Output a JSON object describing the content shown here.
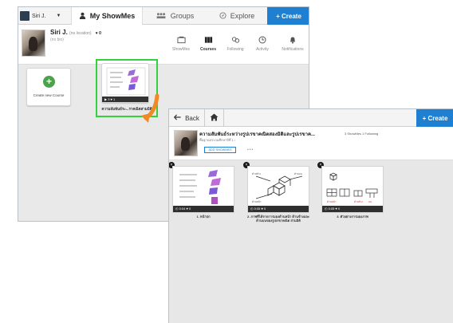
{
  "colors": {
    "accent": "#1f7fd1",
    "highlight": "#34d13c",
    "arrow": "#f08a24",
    "create_plus": "#4aa34a"
  },
  "back_window": {
    "topbar": {
      "user": "Siri J.",
      "tabs": [
        {
          "label": "My ShowMes",
          "icon": "person-icon"
        },
        {
          "label": "Groups",
          "icon": "group-icon"
        },
        {
          "label": "Explore",
          "icon": "compass-icon"
        }
      ],
      "create": "+ Create"
    },
    "profile": {
      "name": "Siri J.",
      "location": "(no location)",
      "count": "♥ 0",
      "sub": "(no bio)"
    },
    "nav": [
      {
        "label": "ShowMes",
        "icon": "showmes-icon"
      },
      {
        "label": "Courses",
        "icon": "courses-icon"
      },
      {
        "label": "Following",
        "icon": "following-icon"
      },
      {
        "label": "Activity",
        "icon": "activity-icon"
      },
      {
        "label": "Notifications",
        "icon": "bell-icon"
      }
    ],
    "create_course_label": "Create new Course",
    "course": {
      "title": "ความสัมพันธ์ระ...ราคณิตสามมิติ",
      "bar": "▶ 3  ♥ 1"
    }
  },
  "front_window": {
    "back_label": "Back",
    "create": "+ Create",
    "course_title": "ความสัมพันธ์ระหว่างรูปเรขาคณิตสองมิติและรูปเรขาค...",
    "course_sub": "พื้นฐานประถมศึกษาปีที่ 1 ›",
    "stats": "3 ShowMes   1 Following",
    "add_label": "ADD SHOWMES",
    "dots": "•••",
    "showmes": [
      {
        "bar": "◴ 0:04  ♥ 0",
        "caption": "1. หน้าปก"
      },
      {
        "bar": "◴ 0:05  ♥ 0",
        "caption": "2. ภาพที่ได้จากการมองด้านหน้า ด้านข้างและด้านบนของรูปเรขาคณิต สามมิติ"
      },
      {
        "bar": "◴ 0:05  ♥ 0",
        "caption": "3. ตัวอย่างการมองภาพ"
      }
    ]
  }
}
